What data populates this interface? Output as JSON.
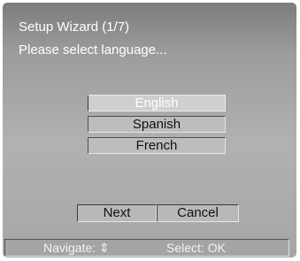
{
  "wizard": {
    "title": "Setup Wizard (1/7)",
    "prompt": "Please select language..."
  },
  "languages": [
    {
      "label": "English",
      "selected": true
    },
    {
      "label": "Spanish",
      "selected": false
    },
    {
      "label": "French",
      "selected": false
    }
  ],
  "buttons": {
    "next": "Next",
    "cancel": "Cancel"
  },
  "status": {
    "navigate": "Navigate: ⇕",
    "select": "Select: OK"
  },
  "colors": {
    "text_light": "#ffffff",
    "panel_gray": "#a6a6a6",
    "selected_bg": "#cfcfcf"
  }
}
